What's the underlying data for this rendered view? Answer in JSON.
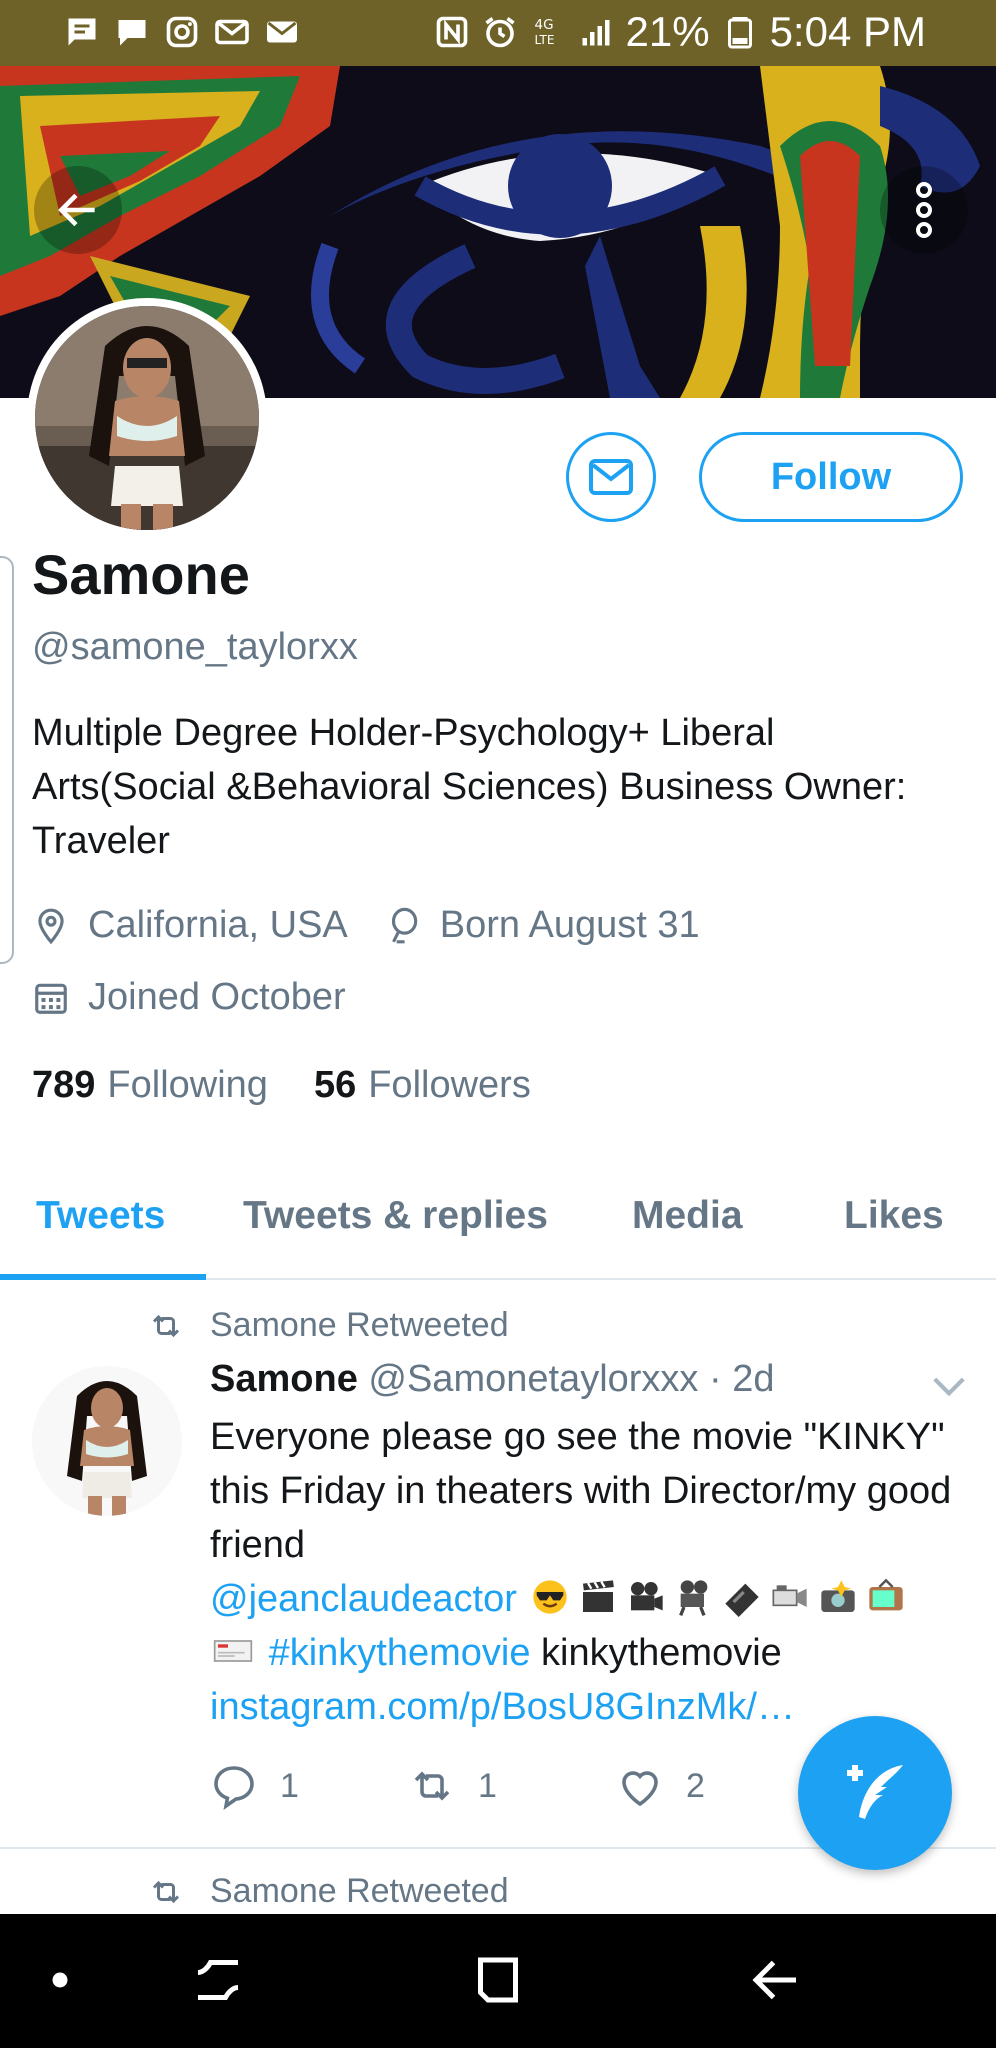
{
  "status_bar": {
    "battery": "21%",
    "time": "5:04 PM",
    "network": "4G LTE",
    "left_icons": [
      "message-icon",
      "chat-icon",
      "instagram-icon",
      "gmail-icon",
      "email-icon"
    ],
    "right_icons": [
      "nfc-icon",
      "alarm-icon",
      "signal-icon",
      "battery-icon"
    ]
  },
  "profile": {
    "name": "Samone",
    "handle": "@samone_taylorxx",
    "bio": "Multiple Degree Holder-Psychology+ Liberal Arts(Social &Behavioral Sciences) Business Owner: Traveler",
    "location": "California, USA",
    "birthday": "Born August 31",
    "joined": "Joined October",
    "following_count": "789",
    "following_label": "Following",
    "followers_count": "56",
    "followers_label": "Followers",
    "follow_label": "Follow"
  },
  "tabs": [
    {
      "label": "Tweets",
      "active": true
    },
    {
      "label": "Tweets & replies",
      "active": false
    },
    {
      "label": "Media",
      "active": false
    },
    {
      "label": "Likes",
      "active": false
    }
  ],
  "tweets": [
    {
      "retweet_label": "Samone Retweeted",
      "author": "Samone",
      "handle": "@Samonetaylorxxx",
      "time": "· 2d",
      "text_1": "Everyone please go see the movie \"KINKY\" this Friday in theaters with Director/my good friend",
      "mention": "@jeanclaudeactor",
      "hashtag": "#kinkythemovie",
      "text_2": "kinkythemovie",
      "link": "instagram.com/p/BosU8GInzMk/…",
      "replies": "1",
      "retweets": "1",
      "likes": "2"
    },
    {
      "retweet_label": "Samone Retweeted"
    }
  ],
  "colors": {
    "accent": "#1da1f2",
    "status_bar": "#6e6229",
    "secondary_text": "#657786"
  }
}
